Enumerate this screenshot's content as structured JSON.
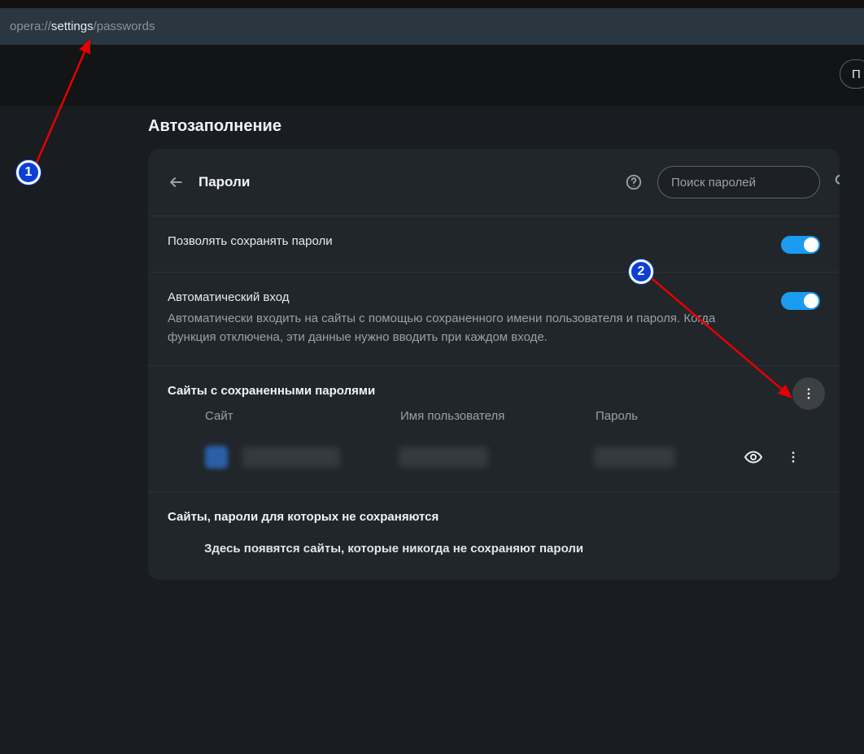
{
  "url": {
    "prefix": "opera://",
    "main": "settings",
    "suffix": "/passwords"
  },
  "header_button_fragment": "П",
  "section_title": "Автозаполнение",
  "card": {
    "title": "Пароли",
    "search_placeholder": "Поиск паролей",
    "save_passwords": {
      "label": "Позволять сохранять пароли",
      "enabled": true
    },
    "auto_signin": {
      "label": "Автоматический вход",
      "description": "Автоматически входить на сайты с помощью сохраненного имени пользователя и пароля. Когда функция отключена, эти данные нужно вводить при каждом входе.",
      "enabled": true
    },
    "saved": {
      "title": "Сайты с сохраненными паролями",
      "columns": {
        "site": "Сайт",
        "username": "Имя пользователя",
        "password": "Пароль"
      }
    },
    "never": {
      "title": "Сайты, пароли для которых не сохраняются",
      "empty": "Здесь появятся сайты, которые никогда не сохраняют пароли"
    }
  },
  "annotations": {
    "marker1": "1",
    "marker2": "2"
  }
}
